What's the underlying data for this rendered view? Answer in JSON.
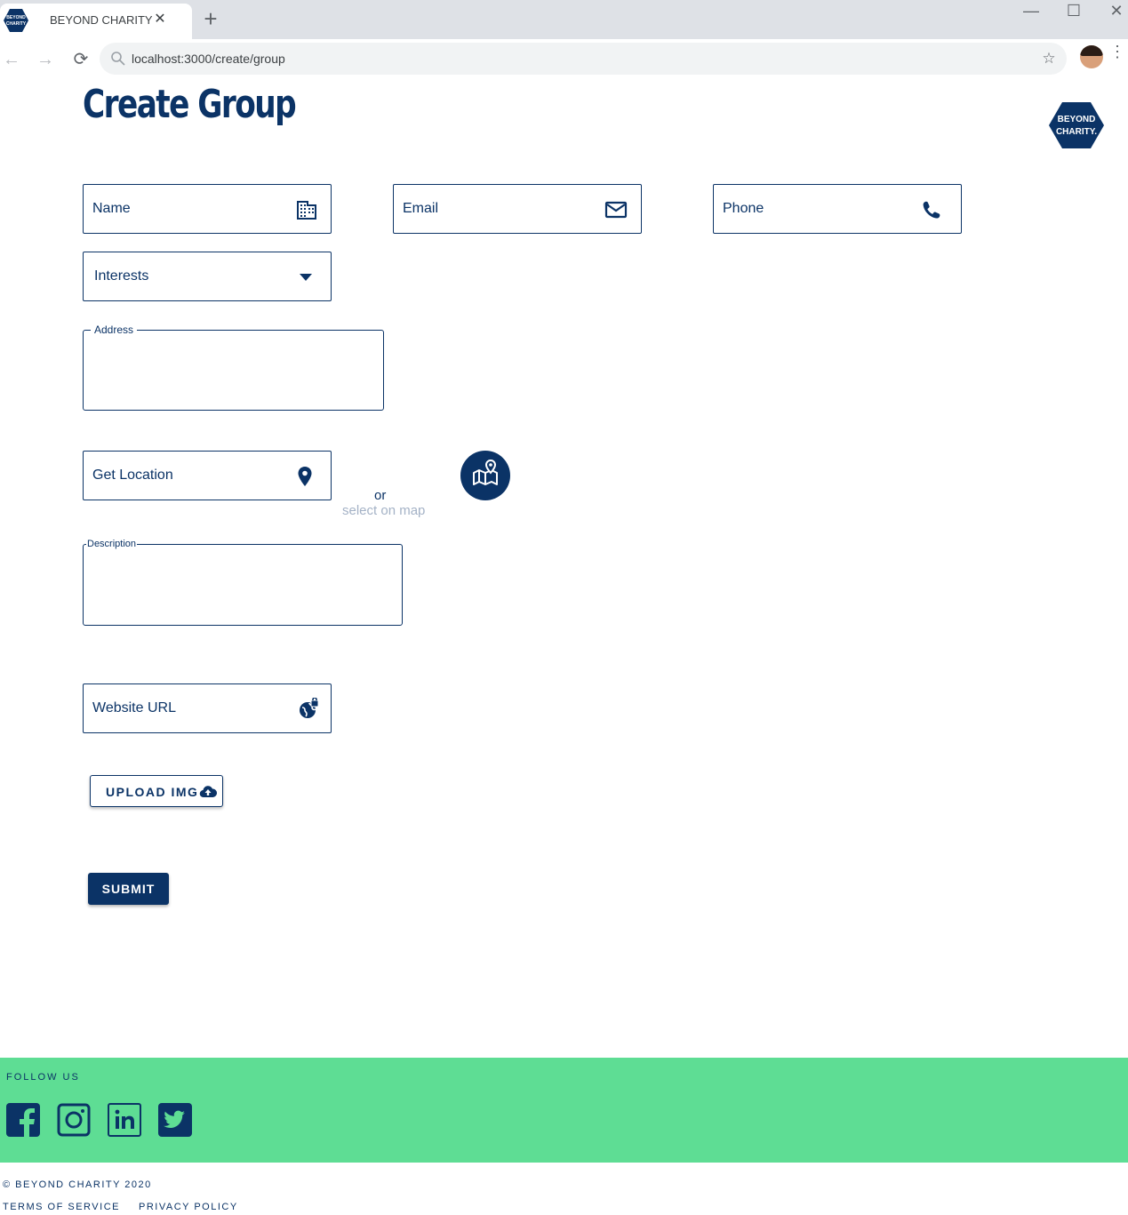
{
  "browser": {
    "tab_title": "BEYOND CHARITY",
    "tab_close": "✕",
    "new_tab": "+",
    "url": "localhost:3000/create/group",
    "window_controls": {
      "minimize": "—",
      "maximize": "☐",
      "close": "✕"
    },
    "nav": {
      "back": "←",
      "forward": "→",
      "reload": "⟳",
      "star": "☆",
      "menu": "⋮"
    },
    "favicon_text": [
      "BEYOND",
      "CHARITY"
    ]
  },
  "page": {
    "title": "Create Group",
    "logo_text": [
      "BEYOND",
      "CHARITY."
    ]
  },
  "form": {
    "name": {
      "label": "Name",
      "icon": "business-icon"
    },
    "email": {
      "label": "Email",
      "icon": "mail-icon"
    },
    "phone": {
      "label": "Phone",
      "icon": "phone-icon"
    },
    "interests": {
      "label": "Interests",
      "icon": "dropdown-arrow-icon"
    },
    "address": {
      "legend": "Address",
      "value": ""
    },
    "get_location": {
      "label": "Get Location",
      "icon": "location-pin-icon"
    },
    "or_text": "or",
    "select_on_map": "select on map",
    "map_button_icon": "map-pin-icon",
    "description": {
      "legend": "Description",
      "value": ""
    },
    "website": {
      "label": "Website URL",
      "icon": "public-globe-icon"
    },
    "upload": {
      "label": "UPLOAD IMG",
      "icon": "cloud-upload-icon"
    },
    "submit": {
      "label": "SUBMIT"
    }
  },
  "footer": {
    "follow_us": "FOLLOW US",
    "social": [
      {
        "name": "facebook",
        "icon": "facebook-icon"
      },
      {
        "name": "instagram",
        "icon": "instagram-icon"
      },
      {
        "name": "linkedin",
        "icon": "linkedin-icon"
      },
      {
        "name": "twitter",
        "icon": "twitter-icon"
      }
    ],
    "copyright": "© BEYOND CHARITY 2020",
    "terms": "TERMS OF SERVICE",
    "privacy": "PRIVACY POLICY"
  },
  "colors": {
    "brand_navy": "#0b3366",
    "footer_green": "#5edd94",
    "muted_link": "#a4b2c6"
  }
}
